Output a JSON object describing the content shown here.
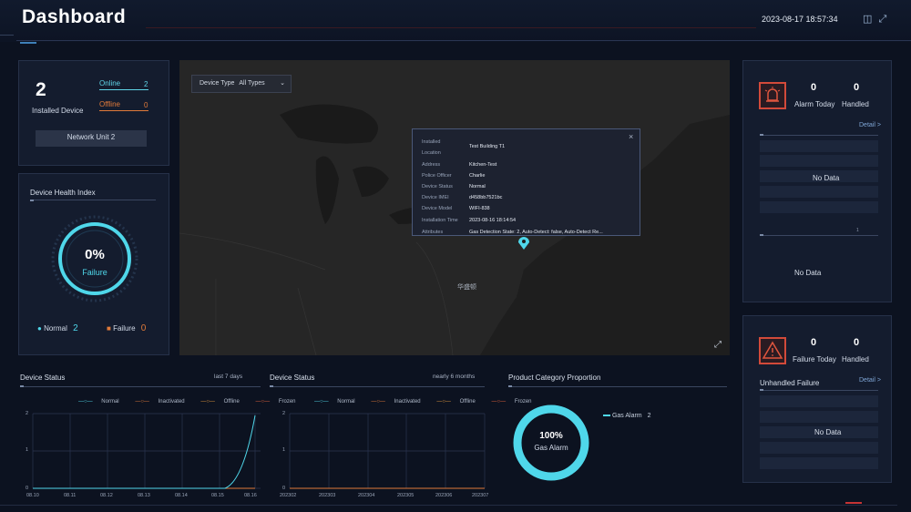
{
  "header": {
    "title": "Dashboard",
    "datetime": "2023-08-17  18:57:34",
    "icons": [
      "layout-icon",
      "fullscreen-icon"
    ]
  },
  "installed": {
    "count": "2",
    "label": "Installed Device",
    "online_label": "Online",
    "online_value": "2",
    "offline_label": "Offline",
    "offline_value": "0",
    "network_unit": "Network Unit  2"
  },
  "health": {
    "title": "Device Health Index",
    "percent": "0%",
    "caption": "Failure",
    "normal_label": "Normal",
    "normal_value": "2",
    "failure_label": "Failure",
    "failure_value": "0"
  },
  "map": {
    "device_type_label": "Device Type",
    "device_type_value": "All Types",
    "place_label": "华盛顿",
    "popup": {
      "rows": [
        {
          "label": "Installed",
          "value": "Test Building T1"
        },
        {
          "label": "Location",
          "value": ""
        },
        {
          "label": "Address",
          "value": "Kitchen-Test"
        },
        {
          "label": "Police Officer",
          "value": "Charlie"
        },
        {
          "label": "Device Status",
          "value": "Normal"
        },
        {
          "label": "Device IMEI",
          "value": "d458bb7521bc"
        },
        {
          "label": "Device Model",
          "value": "WIFI-838"
        },
        {
          "label": "Installation Time",
          "value": "2023-08-16 18:14:54"
        },
        {
          "label": "Attributes",
          "value": "Gas Detection State: 2, Auto-Detect: false, Auto-Detect Re..."
        }
      ]
    }
  },
  "status7": {
    "title": "Device Status",
    "range": "last 7 days",
    "legend": [
      "Normal",
      "Inactivated",
      "Offline",
      "Frozen"
    ],
    "y_ticks": [
      "2",
      "1",
      "0"
    ],
    "x_ticks": [
      "08.10",
      "08.11",
      "08.12",
      "08.13",
      "08.14",
      "08.15",
      "08.16"
    ]
  },
  "status6m": {
    "title": "Device Status",
    "range": "nearly 6 months",
    "legend": [
      "Normal",
      "Inactivated",
      "Offline",
      "Frozen"
    ],
    "y_ticks": [
      "2",
      "1",
      "0"
    ],
    "x_ticks": [
      "202302",
      "202303",
      "202304",
      "202305",
      "202306",
      "202307"
    ]
  },
  "category": {
    "title": "Product Category Proportion",
    "percent": "100%",
    "caption": "Gas Alarm",
    "legend_name": "Gas Alarm",
    "legend_value": "2"
  },
  "alarm": {
    "today_value": "0",
    "today_label": "Alarm Today",
    "handled_value": "0",
    "handled_label": "Handled",
    "detail": "Detail >",
    "no_data_1": "No Data",
    "no_data_2": "No Data",
    "small_mark": "1"
  },
  "failure": {
    "today_value": "0",
    "today_label": "Failure Today",
    "handled_value": "0",
    "handled_label": "Handled",
    "unhandled_title": "Unhandled Failure",
    "detail": "Detail >",
    "no_data": "No Data"
  },
  "colors": {
    "accent": "#4fd7ea",
    "online": "#5fd3e6",
    "offline": "#e07a3a",
    "alarm": "#d24a3a"
  }
}
